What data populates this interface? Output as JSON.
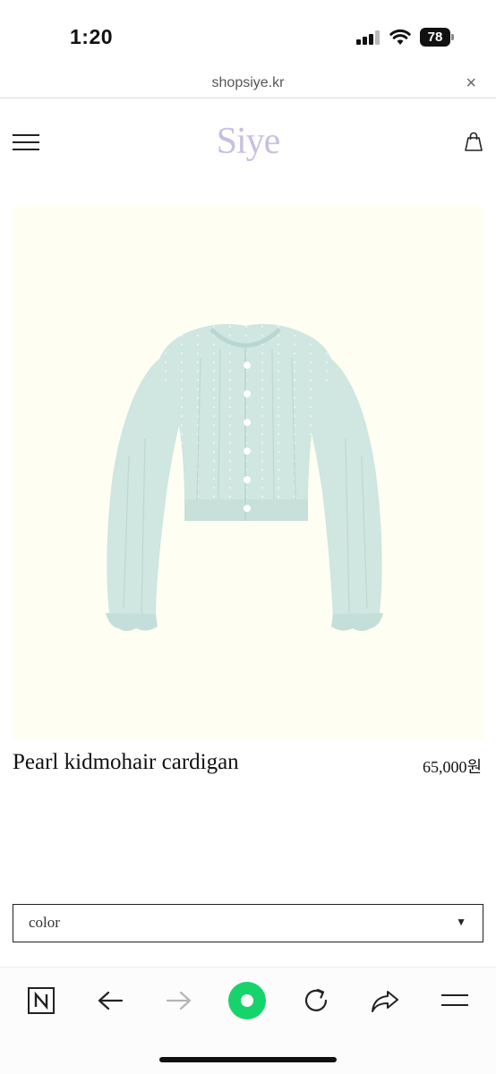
{
  "status_bar": {
    "time": "1:20",
    "battery": "78"
  },
  "browser": {
    "url": "shopsiye.kr",
    "close_glyph": "×"
  },
  "site": {
    "logo": "Siye",
    "menu_icon": "hamburger-icon",
    "cart_icon": "shopping-bag-icon"
  },
  "product": {
    "name": "Pearl kidmohair cardigan",
    "price": "65,000원",
    "image": "mint-green-knit-cardigan",
    "image_bg_color": "#fffef3",
    "garment_color": "#cfe6e1"
  },
  "options": {
    "color_select_label": "color",
    "caret_glyph": "▼"
  },
  "bottom_nav": {
    "items": [
      "naver-n-icon",
      "back-arrow-icon",
      "forward-arrow-icon",
      "home-green-icon",
      "refresh-icon",
      "share-icon",
      "menu-icon"
    ],
    "accent": "#17d36b"
  }
}
